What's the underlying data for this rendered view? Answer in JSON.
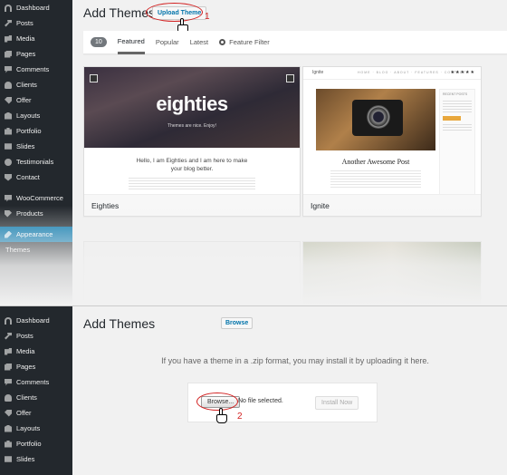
{
  "sidebar_top": {
    "items": [
      {
        "label": "Dashboard",
        "icon": "dashboard-icon"
      },
      {
        "label": "Posts",
        "icon": "pin-icon"
      },
      {
        "label": "Media",
        "icon": "media-icon"
      },
      {
        "label": "Pages",
        "icon": "pages-icon"
      },
      {
        "label": "Comments",
        "icon": "comments-icon"
      },
      {
        "label": "Clients",
        "icon": "clients-icon"
      },
      {
        "label": "Offer",
        "icon": "offer-icon"
      },
      {
        "label": "Layouts",
        "icon": "layouts-icon"
      },
      {
        "label": "Portfolio",
        "icon": "portfolio-icon"
      },
      {
        "label": "Slides",
        "icon": "slides-icon"
      },
      {
        "label": "Testimonials",
        "icon": "testimonials-icon"
      },
      {
        "label": "Contact",
        "icon": "contact-icon"
      },
      {
        "label": "WooCommerce",
        "icon": "woocommerce-icon"
      },
      {
        "label": "Products",
        "icon": "products-icon"
      },
      {
        "label": "Appearance",
        "icon": "appearance-icon"
      },
      {
        "label": "Themes",
        "icon": ""
      }
    ]
  },
  "sidebar_bottom": {
    "items": [
      {
        "label": "Dashboard"
      },
      {
        "label": "Posts"
      },
      {
        "label": "Media"
      },
      {
        "label": "Pages"
      },
      {
        "label": "Comments"
      },
      {
        "label": "Clients"
      },
      {
        "label": "Offer"
      },
      {
        "label": "Layouts"
      },
      {
        "label": "Portfolio"
      },
      {
        "label": "Slides"
      }
    ]
  },
  "top": {
    "title": "Add Themes",
    "upload_button": "Upload Theme",
    "step_marker": "1",
    "filter": {
      "count": "10",
      "tabs": [
        "Featured",
        "Popular",
        "Latest"
      ],
      "feature_filter": "Feature Filter"
    },
    "themes": [
      {
        "name": "Eighties",
        "logo": "eighties",
        "tagline": "Themes are nice. Enjoy!",
        "hello": "Hello, I am Eighties and I am here to make your blog better."
      },
      {
        "name": "Ignite",
        "post_title": "Another Awesome Post",
        "nav": "HOME · BLOG · ABOUT · FEATURES · CONTACT",
        "stars": "★★★★★",
        "sidebar_title": "RECENT POSTS"
      }
    ]
  },
  "bottom": {
    "title": "Add Themes",
    "browse_button": "Browse",
    "help_text": "If you have a theme in a .zip format, you may install it by uploading it here.",
    "file_button": "Browse...",
    "file_status": "No file selected.",
    "install_button": "Install Now",
    "step_marker": "2"
  },
  "colors": {
    "sidebar_bg": "#23282d",
    "accent": "#0073aa",
    "annotation": "#d21f1f"
  }
}
